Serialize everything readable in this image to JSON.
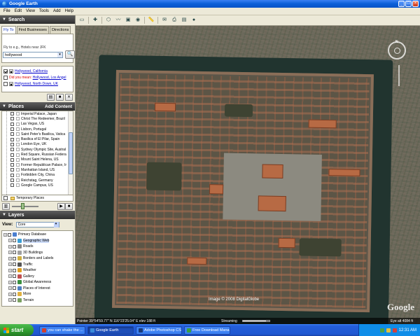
{
  "window": {
    "title": "Google Earth"
  },
  "menu": [
    "File",
    "Edit",
    "View",
    "Tools",
    "Add",
    "Help"
  ],
  "search": {
    "header": "Search",
    "tabs": [
      "Fly To",
      "Find Businesses",
      "Directions"
    ],
    "hint": "Fly to e.g., Hotels near JFK",
    "value": "hollywood",
    "results": [
      {
        "text": "Hollywood, California",
        "style": "link",
        "checked": true
      },
      {
        "prefix": "Did you mean:",
        "text": "Hollywood, Los Angel",
        "style": "link"
      },
      {
        "text": "Hollywood, North Down, UK",
        "style": "link"
      }
    ]
  },
  "places": {
    "header": "Places",
    "add_content": "Add Content",
    "items": [
      "Imperial Palace, Japan",
      "Christ The Redeemer, Brazil",
      "Las Vegas, US",
      "Lisbon, Portugal",
      "Saint Peter's Basilica, Vatica",
      "Basilica of El Pilar, Spain",
      "London Eye, UK",
      "Sydney Olympic Site, Austral",
      "Red Square, Russian Federa",
      "Mount Saint Helena, US",
      "Former Republican Palace, Ir",
      "Manhattan Island, US",
      "Forbidden City, China",
      "Reichstag, Germany",
      "Google Campus, US"
    ],
    "temporary": "Temporary Places"
  },
  "layers": {
    "header": "Layers",
    "view_label": "View:",
    "view_value": "Core",
    "items": [
      {
        "label": "Primary Database",
        "color": "#4a7fd0",
        "indent": 0
      },
      {
        "label": "Geographic Web",
        "color": "#3aa0d8",
        "indent": 1,
        "selected": true
      },
      {
        "label": "Roads",
        "color": "#888888",
        "indent": 1
      },
      {
        "label": "3D Buildings",
        "color": "#a0a0a0",
        "indent": 1
      },
      {
        "label": "Borders and Labels",
        "color": "#d0b040",
        "indent": 1
      },
      {
        "label": "Traffic",
        "color": "#555555",
        "indent": 1
      },
      {
        "label": "Weather",
        "color": "#e0a020",
        "indent": 1
      },
      {
        "label": "Gallery",
        "color": "#c05050",
        "indent": 1
      },
      {
        "label": "Global Awareness",
        "color": "#3a9040",
        "indent": 1
      },
      {
        "label": "Places of Interest",
        "color": "#5080c0",
        "indent": 1
      },
      {
        "label": "More",
        "color": "#e0b040",
        "indent": 1
      },
      {
        "label": "Terrain",
        "color": "#7aa060",
        "indent": 1
      }
    ]
  },
  "map": {
    "copyright": "Image © 2008 DigitalGlobe",
    "watermark": "Google",
    "status": {
      "pointer": "Pointer  39°54'59.77\" N   116°23'25.04\" E   elev   188 ft",
      "streaming": "Streaming",
      "progress": 0.86,
      "eye": "Eye alt  4084 ft"
    }
  },
  "taskbar": {
    "start": "start",
    "tasks": [
      {
        "label": "you can shake the ...",
        "color": "#d04030"
      },
      {
        "label": "Google Earth",
        "color": "#3a8ad8",
        "active": true
      },
      {
        "label": "Adobe Photoshop CS3",
        "color": "#1a3a78"
      },
      {
        "label": "Free Download Mana...",
        "color": "#3aa040"
      }
    ],
    "clock": "12:31 AM"
  }
}
